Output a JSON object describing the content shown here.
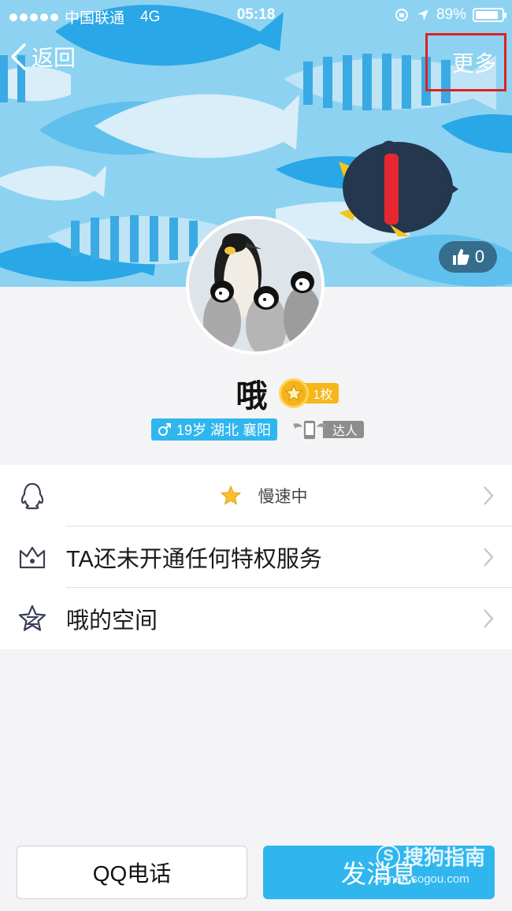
{
  "status_bar": {
    "carrier": "中国联通",
    "network": "4G",
    "time": "05:18",
    "battery": "89%",
    "battery_level": 0.89
  },
  "nav": {
    "back_label": "返回",
    "more_label": "更多"
  },
  "cover": {
    "like_count": "0"
  },
  "profile": {
    "name": "哦",
    "medal_count": "1枚",
    "info_tag": "19岁 湖北 襄阳",
    "talent_label": "达人"
  },
  "list": {
    "qq_status": "慢速中",
    "privilege": "TA还未开通任何特权服务",
    "space": "哦的空间"
  },
  "buttons": {
    "call": "QQ电话",
    "message": "发消息"
  },
  "watermark": {
    "brand": "搜狗指南",
    "url": "zhinan.sogou.com"
  },
  "colors": {
    "accent": "#2fb6ee",
    "highlight_box": "#e02020",
    "medal": "#f7b619"
  }
}
